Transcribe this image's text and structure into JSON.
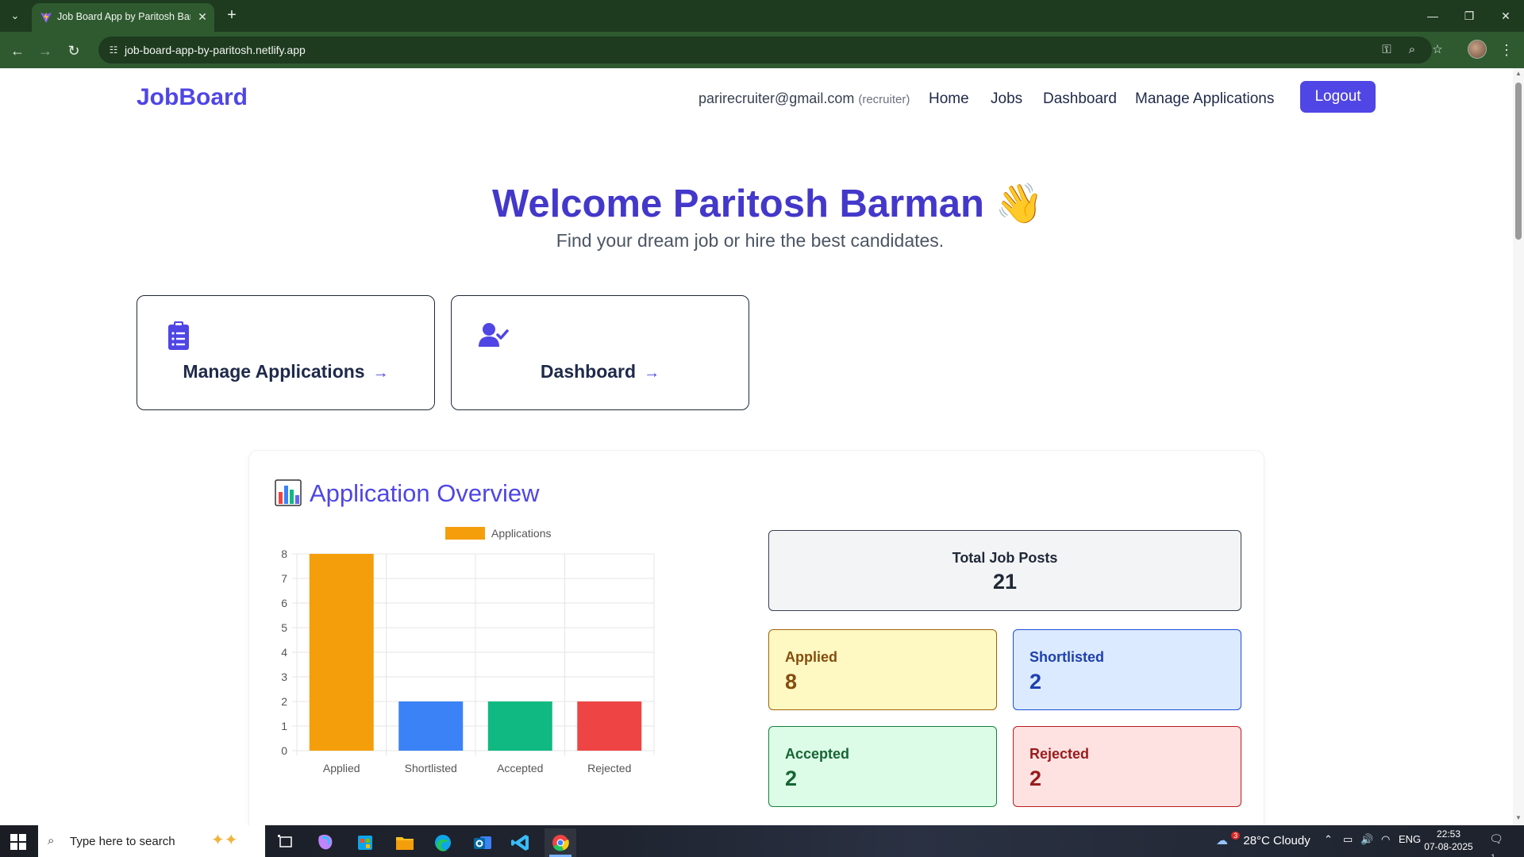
{
  "browser": {
    "tab_title": "Job Board App by Paritosh Barman",
    "url": "job-board-app-by-paritosh.netlify.app"
  },
  "header": {
    "brand": "JobBoard",
    "user_email": "parirecruiter@gmail.com",
    "user_role": "(recruiter)",
    "nav": [
      "Home",
      "Jobs",
      "Dashboard",
      "Manage Applications"
    ],
    "logout_label": "Logout"
  },
  "hero": {
    "title": "Welcome Paritosh Barman 👋",
    "subtitle": "Find your dream job or hire the best candidates."
  },
  "quick_links": [
    {
      "label": "Manage Applications",
      "icon": "clipboard-list-icon"
    },
    {
      "label": "Dashboard",
      "icon": "user-check-icon"
    }
  ],
  "overview": {
    "title": "Application Overview",
    "stats": {
      "total": {
        "label": "Total Job Posts",
        "value": "21"
      },
      "applied": {
        "label": "Applied",
        "value": "8"
      },
      "shortlisted": {
        "label": "Shortlisted",
        "value": "2"
      },
      "accepted": {
        "label": "Accepted",
        "value": "2"
      },
      "rejected": {
        "label": "Rejected",
        "value": "2"
      }
    }
  },
  "chart_data": {
    "type": "bar",
    "categories": [
      "Applied",
      "Shortlisted",
      "Accepted",
      "Rejected"
    ],
    "series": [
      {
        "name": "Applications",
        "values": [
          8,
          2,
          2,
          2
        ]
      }
    ],
    "colors": [
      "#f59e0b",
      "#3b82f6",
      "#10b981",
      "#ef4444"
    ],
    "legend_color": "#f59e0b",
    "ylim": [
      0,
      8
    ],
    "yticks": [
      "0",
      "1",
      "2",
      "3",
      "4",
      "5",
      "6",
      "7",
      "8"
    ],
    "grid": true,
    "legend_position": "top"
  },
  "taskbar": {
    "search_placeholder": "Type here to search",
    "weather": "28°C  Cloudy",
    "weather_badge": "3",
    "language": "ENG",
    "time": "22:53",
    "date": "07-08-2025",
    "notification_count": "1"
  }
}
